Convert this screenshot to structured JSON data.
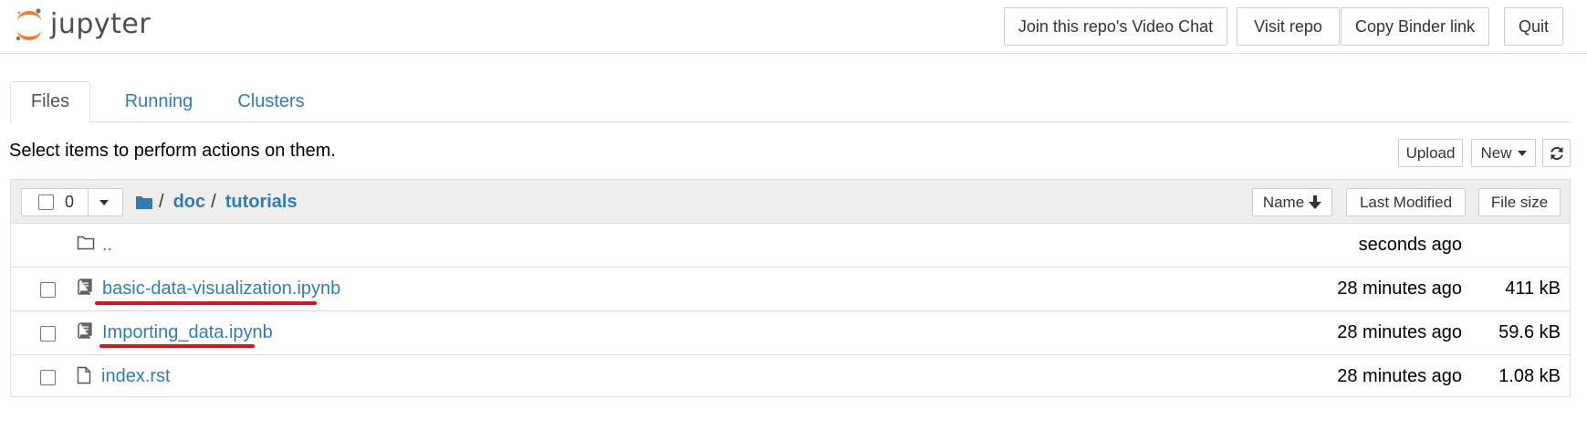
{
  "header": {
    "logo_text": "jupyter",
    "buttons": {
      "video_chat": "Join this repo's Video Chat",
      "visit_repo": "Visit repo",
      "copy_binder": "Copy Binder link",
      "quit": "Quit"
    }
  },
  "tabs": [
    {
      "label": "Files",
      "active": true
    },
    {
      "label": "Running",
      "active": false
    },
    {
      "label": "Clusters",
      "active": false
    }
  ],
  "toolbar": {
    "instructions": "Select items to perform actions on them.",
    "upload_label": "Upload",
    "new_label": "New",
    "refresh_icon": "refresh-icon"
  },
  "list_header": {
    "selected_count": "0",
    "breadcrumb": [
      {
        "label": "doc"
      },
      {
        "label": "tutorials"
      }
    ],
    "breadcrumb_separator": "/",
    "sort_name_label": "Name",
    "sort_name_direction": "arrow-down-icon",
    "sort_modified_label": "Last Modified",
    "sort_size_label": "File size"
  },
  "files": [
    {
      "name": "..",
      "type": "folder",
      "modified": "seconds ago",
      "size": "",
      "has_checkbox": false,
      "icon": "folder-icon"
    },
    {
      "name": "basic-data-visualization.ipynb",
      "type": "notebook",
      "modified": "28 minutes ago",
      "size": "411 kB",
      "has_checkbox": true,
      "icon": "notebook-icon",
      "underlined": true
    },
    {
      "name": "Importing_data.ipynb",
      "type": "notebook",
      "modified": "28 minutes ago",
      "size": "59.6 kB",
      "has_checkbox": true,
      "icon": "notebook-icon",
      "underlined": true
    },
    {
      "name": "index.rst",
      "type": "file",
      "modified": "28 minutes ago",
      "size": "1.08 kB",
      "has_checkbox": true,
      "icon": "file-icon"
    }
  ],
  "colors": {
    "link": "#337ab7",
    "logo_orange": "#f37726",
    "annotation_red": "#d9141e",
    "header_bg": "#eeeeee"
  }
}
